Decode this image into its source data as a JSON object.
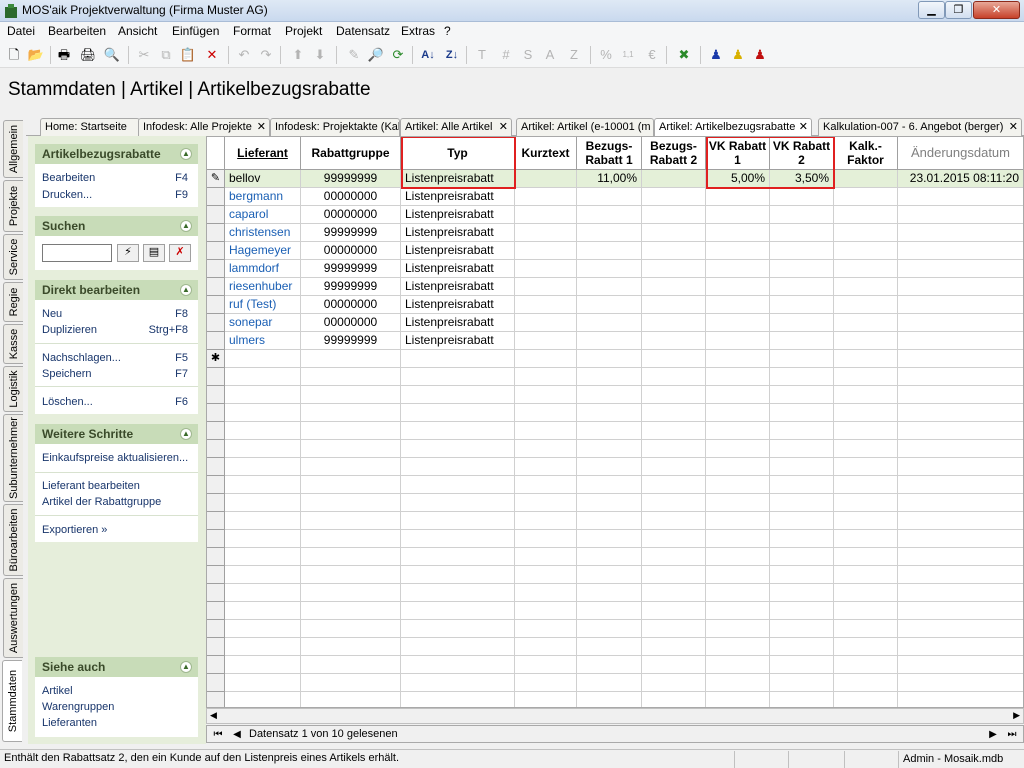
{
  "window": {
    "title": "MOS'aik Projektverwaltung (Firma Muster AG)"
  },
  "menu": [
    "Datei",
    "Bearbeiten",
    "Ansicht",
    "Einfügen",
    "Format",
    "Projekt",
    "Datensatz",
    "Extras",
    "?"
  ],
  "page_title": "Stammdaten | Artikel | Artikelbezugsrabatte",
  "vertical_tabs": [
    "Allgemein",
    "Projekte",
    "Service",
    "Regie",
    "Kasse",
    "Logistik",
    "Subunternehmer",
    "Büroarbeiten",
    "Auswertungen",
    "Stammdaten"
  ],
  "doc_tabs": [
    "Home: Startseite",
    "Infodesk: Alle Projekte",
    "Infodesk: Projektakte (Kalk",
    "Artikel: Alle Artikel",
    "Artikel: Artikel (e-10001 (m",
    "Artikel: Artikelbezugsrabatte",
    "Kalkulation-007 - 6. Angebot (berger)"
  ],
  "panel": {
    "section1": {
      "title": "Artikelbezugsrabatte",
      "items": [
        {
          "label": "Bearbeiten",
          "key": "F4"
        },
        {
          "label": "Drucken...",
          "key": "F9"
        }
      ]
    },
    "section2": {
      "title": "Suchen"
    },
    "section3": {
      "title": "Direkt bearbeiten",
      "items": [
        {
          "label": "Neu",
          "key": "F8"
        },
        {
          "label": "Duplizieren",
          "key": "Strg+F8"
        },
        {
          "label": "Nachschlagen...",
          "key": "F5"
        },
        {
          "label": "Speichern",
          "key": "F7"
        },
        {
          "label": "Löschen...",
          "key": "F6"
        }
      ]
    },
    "section4": {
      "title": "Weitere Schritte",
      "items": [
        "Einkaufspreise aktualisieren...",
        "Lieferant bearbeiten",
        "Artikel der Rabattgruppe",
        "Exportieren »"
      ]
    },
    "section5": {
      "title": "Siehe auch",
      "items": [
        "Artikel",
        "Warengruppen",
        "Lieferanten"
      ]
    }
  },
  "grid": {
    "columns": [
      "Lieferant",
      "Rabattgruppe",
      "Typ",
      "Kurztext",
      "Bezugs-Rabatt 1",
      "Bezugs-Rabatt 2",
      "VK Rabatt 1",
      "VK Rabatt 2",
      "Kalk.-Faktor",
      "Änderungsdatum"
    ],
    "rows": [
      [
        "bellov",
        "99999999",
        "Listenpreisrabatt",
        "",
        "11,00%",
        "",
        "5,00%",
        "3,50%",
        "",
        "23.01.2015 08:11:20"
      ],
      [
        "bergmann",
        "00000000",
        "Listenpreisrabatt",
        "",
        "",
        "",
        "",
        "",
        "",
        ""
      ],
      [
        "caparol",
        "00000000",
        "Listenpreisrabatt",
        "",
        "",
        "",
        "",
        "",
        "",
        ""
      ],
      [
        "christensen",
        "99999999",
        "Listenpreisrabatt",
        "",
        "",
        "",
        "",
        "",
        "",
        ""
      ],
      [
        "Hagemeyer",
        "00000000",
        "Listenpreisrabatt",
        "",
        "",
        "",
        "",
        "",
        "",
        ""
      ],
      [
        "lammdorf",
        "99999999",
        "Listenpreisrabatt",
        "",
        "",
        "",
        "",
        "",
        "",
        ""
      ],
      [
        "riesenhuber",
        "99999999",
        "Listenpreisrabatt",
        "",
        "",
        "",
        "",
        "",
        "",
        ""
      ],
      [
        "ruf (Test)",
        "00000000",
        "Listenpreisrabatt",
        "",
        "",
        "",
        "",
        "",
        "",
        ""
      ],
      [
        "sonepar",
        "00000000",
        "Listenpreisrabatt",
        "",
        "",
        "",
        "",
        "",
        "",
        ""
      ],
      [
        "ulmers",
        "99999999",
        "Listenpreisrabatt",
        "",
        "",
        "",
        "",
        "",
        "",
        ""
      ]
    ]
  },
  "navigator": {
    "text": "Datensatz 1 von 10 gelesenen"
  },
  "status": {
    "message": "Enthält den Rabattsatz 2, den ein Kunde auf den Listenpreis eines Artikels erhält.",
    "user": "Admin - Mosaik.mdb"
  }
}
